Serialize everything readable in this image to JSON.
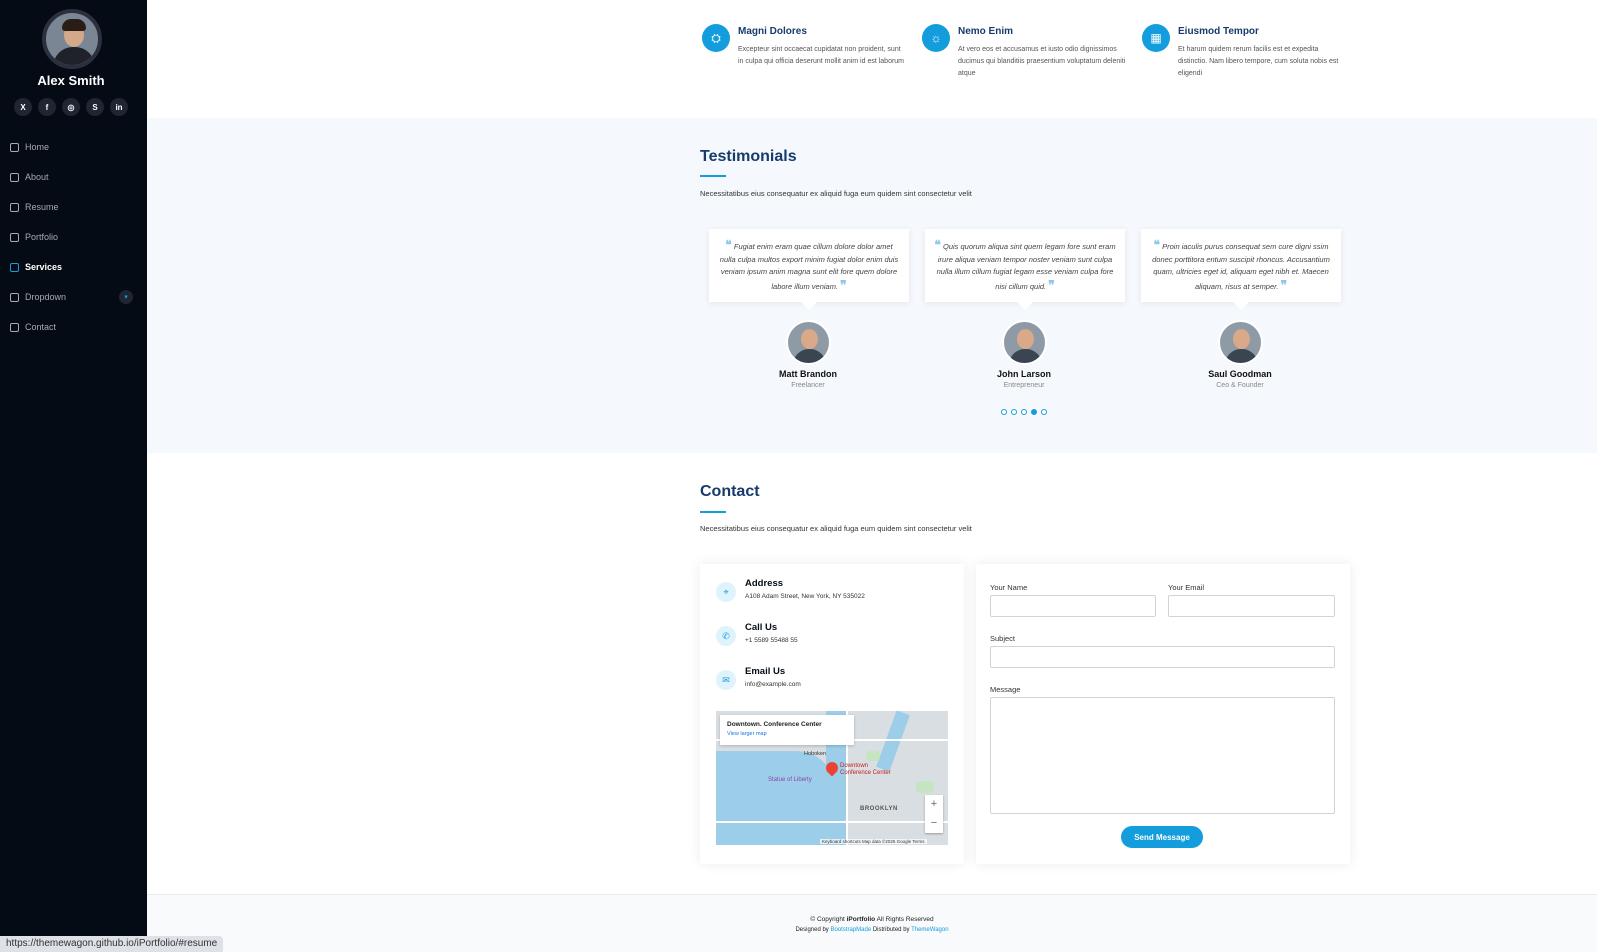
{
  "profile": {
    "name": "Alex Smith"
  },
  "socials": [
    {
      "icon": "x-icon",
      "glyph": "X"
    },
    {
      "icon": "facebook-icon",
      "glyph": "f"
    },
    {
      "icon": "instagram-icon",
      "glyph": "◎"
    },
    {
      "icon": "skype-icon",
      "glyph": "S"
    },
    {
      "icon": "linkedin-icon",
      "glyph": "in"
    }
  ],
  "nav": [
    {
      "label": "Home",
      "icon": "house-icon"
    },
    {
      "label": "About",
      "icon": "person-icon"
    },
    {
      "label": "Resume",
      "icon": "file-icon"
    },
    {
      "label": "Portfolio",
      "icon": "images-icon"
    },
    {
      "label": "Services",
      "icon": "hdd-stack-icon",
      "active": true
    },
    {
      "label": "Dropdown",
      "icon": "menu-icon"
    },
    {
      "label": "Contact",
      "icon": "envelope-icon"
    }
  ],
  "services": [
    {
      "title": "Magni Dolores",
      "desc": "Excepteur sint occaecat cupidatat non proident, sunt in culpa qui officia deserunt mollit anim id est laborum",
      "icon": "binoculars-icon",
      "glyph": "⛭"
    },
    {
      "title": "Nemo Enim",
      "desc": "At vero eos et accusamus et iusto odio dignissimos ducimus qui blanditiis praesentium voluptatum deleniti atque",
      "icon": "brightness-icon",
      "glyph": "☼"
    },
    {
      "title": "Eiusmod Tempor",
      "desc": "Et harum quidem rerum facilis est et expedita distinctio. Nam libero tempore, cum soluta nobis est eligendi",
      "icon": "calendar-icon",
      "glyph": "▦"
    }
  ],
  "testimonials": {
    "title": "Testimonials",
    "subtitle": "Necessitatibus eius consequatur ex aliquid fuga eum quidem sint consectetur velit",
    "items": [
      {
        "quote": "Fugiat enim eram quae cillum dolore dolor amet nulla culpa multos export minim fugiat dolor enim duis veniam ipsum anim magna sunt elit fore quem dolore labore illum veniam.",
        "name": "Matt Brandon",
        "role": "Freelancer"
      },
      {
        "quote": "Quis quorum aliqua sint quem legam fore sunt eram irure aliqua veniam tempor noster veniam sunt culpa nulla illum cillum fugiat legam esse veniam culpa fore nisi cillum quid.",
        "name": "John Larson",
        "role": "Entrepreneur"
      },
      {
        "quote": "Proin iaculis purus consequat sem cure digni ssim donec porttitora entum suscipit rhoncus. Accusantium quam, ultricies eget id, aliquam eget nibh et. Maecen aliquam, risus at semper.",
        "name": "Saul Goodman",
        "role": "Ceo & Founder"
      }
    ],
    "carousel": {
      "pages": 5,
      "active_index": 3
    }
  },
  "contact": {
    "title": "Contact",
    "subtitle": "Necessitatibus eius consequatur ex aliquid fuga eum quidem sint consectetur velit",
    "info": [
      {
        "heading": "Address",
        "value": "A108 Adam Street, New York, NY 535022",
        "icon": "geo-alt-icon",
        "glyph": "⌖"
      },
      {
        "heading": "Call Us",
        "value": "+1 5589 55488 55",
        "icon": "telephone-icon",
        "glyph": "✆"
      },
      {
        "heading": "Email Us",
        "value": "info@example.com",
        "icon": "envelope-icon",
        "glyph": "✉"
      }
    ],
    "map": {
      "place": "Downtown. Conference Center",
      "larger_link": "View larger map",
      "pin_label_1": "Downtown",
      "pin_label_2": "Conference Center",
      "liberty": "Statue of Liberty",
      "brooklyn": "BROOKLYN",
      "hoboken": "Hoboken",
      "footer": "Keyboard shortcuts  Map data ©2025 Google  Terms"
    },
    "form": {
      "name_label": "Your Name",
      "email_label": "Your Email",
      "subject_label": "Subject",
      "message_label": "Message",
      "send_label": "Send Message"
    }
  },
  "footer": {
    "copyright_prefix": "© Copyright",
    "brand": "iPortfolio",
    "copyright_suffix": "All Rights Reserved",
    "designed_prefix": "Designed by",
    "designed_link": "BootstrapMade",
    "distributed_prefix": "Distributed by",
    "distributed_link": "ThemeWagon"
  },
  "status_url": "https://themewagon.github.io/iPortfolio/#resume",
  "colors": {
    "accent": "#149ddd",
    "sidebar": "#040b14",
    "section_bg": "#f5f8fd"
  }
}
